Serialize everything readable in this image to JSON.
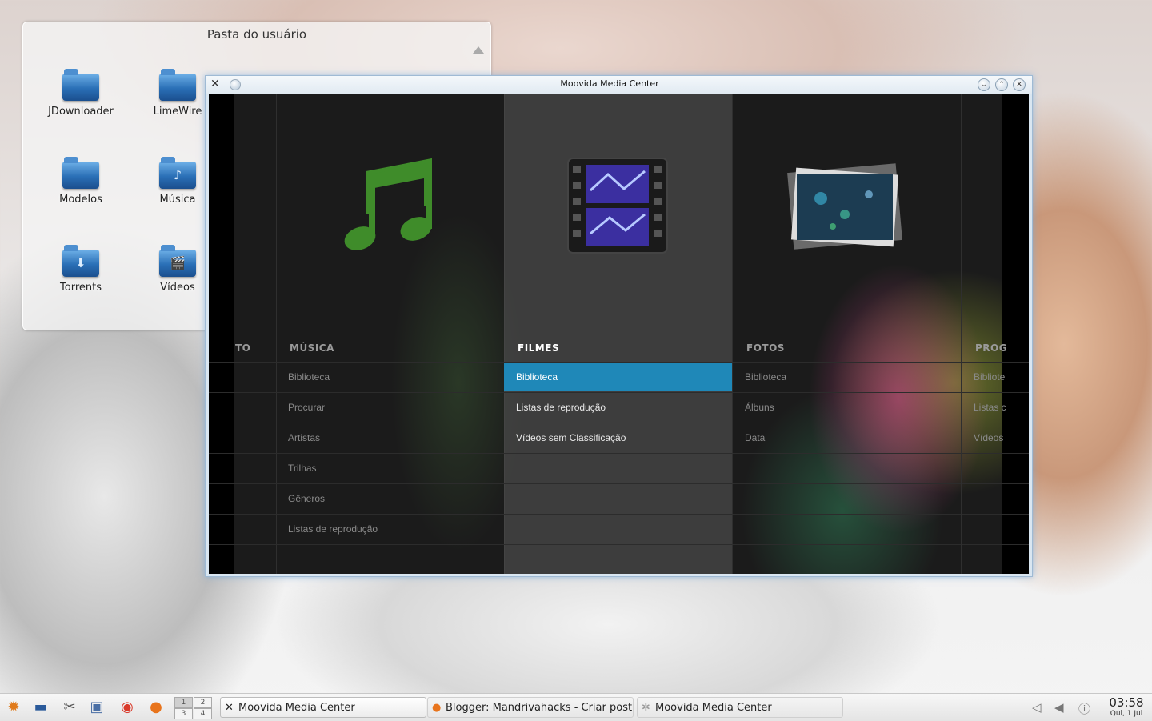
{
  "desktop": {
    "folderview": {
      "title": "Pasta do usuário",
      "items": [
        {
          "label": "JDownloader",
          "icon": "folder-icon",
          "glyph": ""
        },
        {
          "label": "LimeWire",
          "icon": "folder-icon",
          "glyph": ""
        },
        {
          "label": "Modelos",
          "icon": "folder-templates-icon",
          "glyph": ""
        },
        {
          "label": "Música",
          "icon": "folder-music-icon",
          "glyph": "♪"
        },
        {
          "label": "Torrents",
          "icon": "folder-download-icon",
          "glyph": "⬇"
        },
        {
          "label": "Vídeos",
          "icon": "folder-videos-icon",
          "glyph": "🎬"
        }
      ]
    }
  },
  "window": {
    "title": "Moovida Media Center",
    "buttons": [
      "minimize",
      "maximize",
      "close"
    ]
  },
  "media_center": {
    "columns": [
      {
        "id": "partial-left",
        "header": "TO",
        "active": false,
        "items": [
          "",
          "",
          "",
          "",
          ""
        ]
      },
      {
        "id": "musica",
        "header": "MÚSICA",
        "active": false,
        "art": "music-note-icon",
        "items": [
          "Biblioteca",
          "Procurar",
          "Artistas",
          "Trilhas",
          "Gêneros",
          "Listas de reprodução"
        ]
      },
      {
        "id": "filmes",
        "header": "FILMES",
        "active": true,
        "art": "film-strip-icon",
        "items": [
          "Biblioteca",
          "Listas de reprodução",
          "Vídeos sem Classificação"
        ],
        "selected_index": 0
      },
      {
        "id": "fotos",
        "header": "FOTOS",
        "active": false,
        "art": "photo-stack-icon",
        "items": [
          "Biblioteca",
          "Álbuns",
          "Data"
        ]
      },
      {
        "id": "programas",
        "header": "PROG",
        "active": false,
        "items": [
          "Bibliote",
          "Listas c",
          "Vídeos"
        ]
      }
    ]
  },
  "taskbar": {
    "launchers": [
      "kde-menu-icon",
      "desktop-icon",
      "tools-icon",
      "system-settings-icon",
      "chrome-icon",
      "firefox-icon"
    ],
    "pager": [
      "1",
      "2",
      "3",
      "4"
    ],
    "current_desktop": "1",
    "tasks": [
      {
        "label": "Moovida Media Center",
        "icon": "moovida-icon",
        "active": true
      },
      {
        "label": "Blogger: Mandrivahacks - Criar post ao",
        "icon": "firefox-icon",
        "active": false
      },
      {
        "label": "Moovida Media Center",
        "icon": "loading-icon",
        "active": false
      }
    ],
    "clock": {
      "time": "03:58",
      "date": "Qui, 1 Jul"
    }
  }
}
